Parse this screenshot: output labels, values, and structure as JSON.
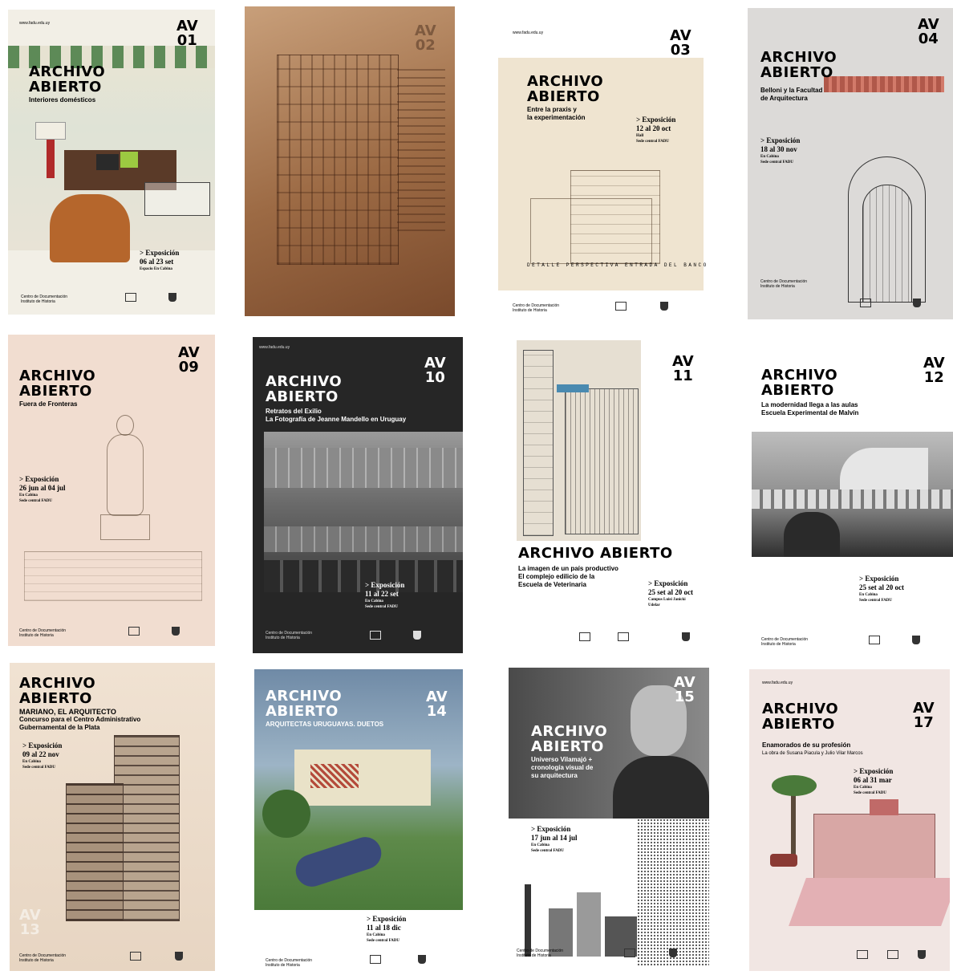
{
  "posters": [
    {
      "id": "p01",
      "num": "01",
      "title1": "ARCHIVO",
      "title2": "ABIERTO",
      "subtitle": "Interiores domésticos",
      "expo": "Exposición",
      "dates": "06 al 23 set",
      "place": "Espacio En Cabina",
      "foot1": "Centro de Documentación",
      "foot2": "Instituto de Historia"
    },
    {
      "id": "p02",
      "num": "02"
    },
    {
      "id": "p03",
      "num": "03",
      "title1": "ARCHIVO",
      "title2": "ABIERTO",
      "subtitle1": "Entre la praxis y",
      "subtitle2": "la experimentación",
      "expo": "Exposición",
      "dates": "12 al 20 oct",
      "place": "Hall",
      "place2": "Sede central FADU",
      "caption": "DETALLE PERSPECTIVA ENTRADA DEL BANCO",
      "foot1": "Centro de Documentación",
      "foot2": "Instituto de Historia"
    },
    {
      "id": "p04",
      "num": "04",
      "title1": "ARCHIVO",
      "title2": "ABIERTO",
      "subtitle1": "Belloni y la Facultad",
      "subtitle2": "de Arquitectura",
      "expo": "Exposición",
      "dates": "18 al 30 nov",
      "place": "En Cabina",
      "place2": "Sede central FADU",
      "foot1": "Centro de Documentación",
      "foot2": "Instituto de Historia"
    },
    {
      "id": "p09",
      "num": "09",
      "title1": "ARCHIVO",
      "title2": "ABIERTO",
      "subtitle": "Fuera de Fronteras",
      "expo": "Exposición",
      "dates": "26 jun al 04 jul",
      "place": "En Cabina",
      "place2": "Sede central FADU",
      "foot1": "Centro de Documentación",
      "foot2": "Instituto de Historia"
    },
    {
      "id": "p10",
      "num": "10",
      "title1": "ARCHIVO",
      "title2": "ABIERTO",
      "subtitle1": "Retratos del Exilio",
      "subtitle2": "La Fotografía de Jeanne Mandello en Uruguay",
      "expo": "Exposición",
      "dates": "11 al 22 set",
      "place": "En Cabina",
      "place2": "Sede central FADU",
      "foot1": "Centro de Documentación",
      "foot2": "Instituto de Historia"
    },
    {
      "id": "p11",
      "num": "11",
      "title": "ARCHIVO ABIERTO",
      "subtitle1": "La imagen de un país productivo",
      "subtitle2": "El complejo edilicio de la",
      "subtitle3": "Escuela de Veterinaria",
      "expo": "Exposición",
      "dates": "25 set al 20 oct",
      "place": "Campus Luisi Janicki",
      "place2": "Udelar"
    },
    {
      "id": "p12",
      "num": "12",
      "title1": "ARCHIVO",
      "title2": "ABIERTO",
      "subtitle1": "La modernidad llega a las aulas",
      "subtitle2": "Escuela Experimental de Malvín",
      "expo": "Exposición",
      "dates": "25 set al 20 oct",
      "place": "En Cabina",
      "place2": "Sede central FADU",
      "foot1": "Centro de Documentación",
      "foot2": "Instituto de Historia"
    },
    {
      "id": "p13",
      "num": "13",
      "title1": "ARCHIVO",
      "title2": "ABIERTO",
      "subtitle1": "MARIANO, EL ARQUITECTO",
      "subtitle2": "Concurso para el Centro Administrativo",
      "subtitle3": "Gubernamental de la Plata",
      "expo": "Exposición",
      "dates": "09 al 22 nov",
      "place": "En Cabina",
      "place2": "Sede central FADU",
      "foot1": "Centro de Documentación",
      "foot2": "Instituto de Historia"
    },
    {
      "id": "p14",
      "num": "14",
      "title1": "ARCHIVO",
      "title2": "ABIERTO",
      "subtitle": "ARQUITECTAS URUGUAYAS. DUETOS",
      "expo": "Exposición",
      "dates": "11 al 18 dic",
      "place": "En Cabina",
      "place2": "Sede central FADU",
      "foot1": "Centro de Documentación",
      "foot2": "Instituto de Historia"
    },
    {
      "id": "p15",
      "num": "15",
      "title1": "ARCHIVO",
      "title2": "ABIERTO",
      "subtitle1": "Universo Vilamajó +",
      "subtitle2": "cronología visual de",
      "subtitle3": "su arquitectura",
      "expo": "Exposición",
      "dates": "17 jun al 14 jul",
      "place": "En Cabina",
      "place2": "Sede central FADU",
      "foot1": "Centro de Documentación",
      "foot2": "Instituto de Historia"
    },
    {
      "id": "p17",
      "num": "17",
      "title1": "ARCHIVO",
      "title2": "ABIERTO",
      "subtitle1": "Enamorados de su profesión",
      "subtitle2": "La obra de Susana Piacula y Julio Vilar Marcos",
      "expo": "Exposición",
      "dates": "06 al 31 mar",
      "place": "En Cabina",
      "place2": "Sede central FADU"
    }
  ],
  "logo_mark": "AV",
  "arrow": ">",
  "url": "www.fadu.edu.uy",
  "colors": {
    "ink": "#1a1a1a",
    "paper": "#efe6d8",
    "sepia": "#8a5a3a",
    "dark": "#262626"
  }
}
